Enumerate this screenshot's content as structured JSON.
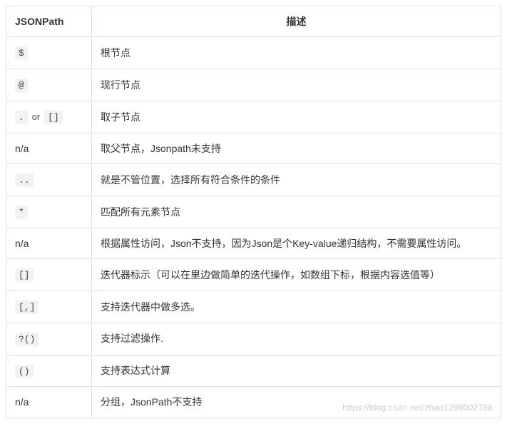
{
  "headers": {
    "jsonpath": "JSONPath",
    "description": "描述"
  },
  "or_label": "or",
  "rows": [
    {
      "kind": "code",
      "jp": "$",
      "desc": "根节点"
    },
    {
      "kind": "code",
      "jp": "@",
      "desc": "现行节点"
    },
    {
      "kind": "code2",
      "jp1": ".",
      "jp2": "[]",
      "desc": "取子节点"
    },
    {
      "kind": "plain",
      "jp": "n/a",
      "desc": "取父节点，Jsonpath未支持"
    },
    {
      "kind": "code",
      "jp": "..",
      "desc": "就是不管位置，选择所有符合条件的条件"
    },
    {
      "kind": "code",
      "jp": "*",
      "desc": "匹配所有元素节点"
    },
    {
      "kind": "plain",
      "jp": "n/a",
      "desc": "根据属性访问，Json不支持，因为Json是个Key-value递归结构，不需要属性访问。"
    },
    {
      "kind": "code",
      "jp": "[]",
      "desc": "迭代器标示（可以在里边做简单的迭代操作，如数组下标，根据内容选值等）"
    },
    {
      "kind": "code",
      "jp": "[,]",
      "desc": "支持迭代器中做多选。"
    },
    {
      "kind": "code",
      "jp": "?()",
      "desc": "支持过滤操作."
    },
    {
      "kind": "code",
      "jp": "()",
      "desc": "支持表达式计算"
    },
    {
      "kind": "plain",
      "jp": "n/a",
      "desc": "分组，JsonPath不支持"
    }
  ],
  "watermark": "https://blog.csdn.net/zhao1299002788"
}
